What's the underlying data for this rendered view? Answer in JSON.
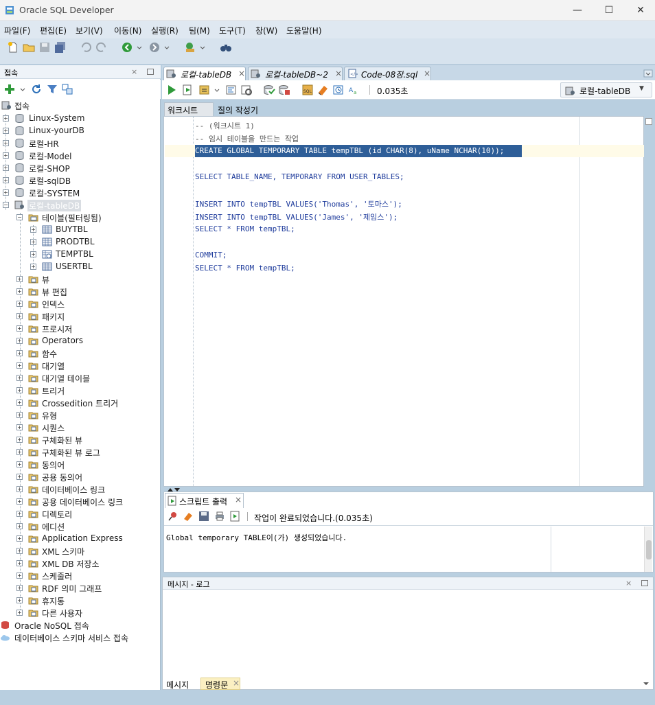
{
  "window": {
    "title": "Oracle SQL Developer",
    "minimize": "—",
    "maximize": "☐",
    "close": "✕"
  },
  "menu": [
    "파일(F)",
    "편집(E)",
    "보기(V)",
    "이동(N)",
    "실행(R)",
    "팀(M)",
    "도구(T)",
    "창(W)",
    "도움말(H)"
  ],
  "left_panel": {
    "title": "접속",
    "root": "접속",
    "connections": [
      "Linux-System",
      "Linux-yourDB",
      "로컬-HR",
      "로컬-Model",
      "로컬-SHOP",
      "로컬-sqlDB",
      "로컬-SYSTEM",
      "로컬-tableDB"
    ],
    "tables_node": "테이블(필터링됨)",
    "tables": [
      "BUYTBL",
      "PRODTBL",
      "TEMPTBL",
      "USERTBL"
    ],
    "object_nodes": [
      "뷰",
      "뷰 편집",
      "인덱스",
      "패키지",
      "프로시저",
      "Operators",
      "함수",
      "대기열",
      "대기열 테이블",
      "트리거",
      "Crossedition 트리거",
      "유형",
      "시퀀스",
      "구체화된 뷰",
      "구체화된 뷰 로그",
      "동의어",
      "공용 동의어",
      "데이터베이스 링크",
      "공용 데이터베이스 링크",
      "디렉토리",
      "에디션",
      "Application Express",
      "XML 스키마",
      "XML DB 저장소",
      "스케줄러",
      "RDF 의미 그래프",
      "휴지통",
      "다른 사용자"
    ],
    "bottom_nodes": [
      "Oracle NoSQL 접속",
      "데이터베이스 스키마 서비스 접속"
    ]
  },
  "editor": {
    "tabs": [
      "로컬-tableDB",
      "로컬-tableDB~2",
      "Code-08장.sql"
    ],
    "elapsed": "0.035초",
    "connection": "로컬-tableDB",
    "subtabs": [
      "워크시트",
      "질의 작성기"
    ],
    "lines": [
      "-- (워크시트 1)",
      "-- 임시 테이블을 만드는 작업",
      "CREATE GLOBAL TEMPORARY TABLE tempTBL (id CHAR(8), uName NCHAR(10));",
      "",
      "SELECT TABLE_NAME, TEMPORARY FROM USER_TABLES;",
      "",
      "INSERT INTO tempTBL VALUES('Thomas', '토마스');",
      "INSERT INTO tempTBL VALUES('James', '제임스');",
      "SELECT * FROM tempTBL;",
      "",
      "COMMIT;",
      "SELECT * FROM tempTBL;"
    ]
  },
  "script_output": {
    "title": "스크립트 출력",
    "status": "작업이 완료되었습니다.(0.035초)",
    "text": "Global temporary TABLE이(가) 생성되었습니다."
  },
  "messages": {
    "title": "메시지 - 로그",
    "tabs": [
      "메시지",
      "명령문"
    ]
  },
  "colors": {
    "accent": "#2e5e98",
    "keyword": "#1f3c9c",
    "frame": "#b9cfe0"
  }
}
